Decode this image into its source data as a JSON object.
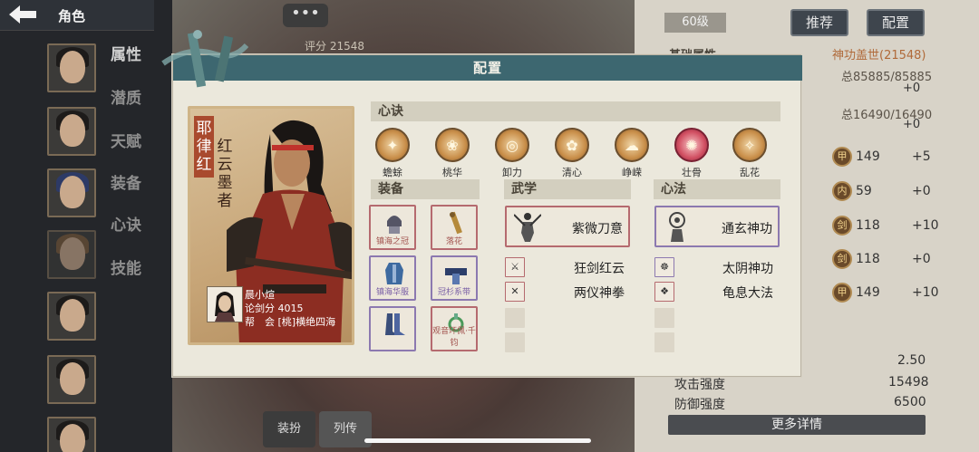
{
  "topbar": {
    "back_icon": "back-arrow-icon",
    "title": "角色"
  },
  "side_menu": [
    "属性",
    "潜质",
    "天赋",
    "装备",
    "心诀",
    "技能"
  ],
  "header": {
    "level": "60级",
    "recommend_label": "推荐",
    "config_label": "配置",
    "chat_label": "•••",
    "score": "评分 21548"
  },
  "stats_panel": {
    "base_label": "基础属性",
    "hero_title": "神功盖世(21548)",
    "hp": "总85885/85885",
    "hp_inc": "+0",
    "mp": "总16490/16490",
    "mp_inc": "+0",
    "rows": [
      {
        "icon": "甲",
        "value": "149",
        "inc": "+5"
      },
      {
        "icon": "内",
        "value": "59",
        "inc": "+0"
      },
      {
        "icon": "剑",
        "value": "118",
        "inc": "+10"
      },
      {
        "icon": "剑",
        "value": "118",
        "inc": "+0"
      },
      {
        "icon": "甲",
        "value": "149",
        "inc": "+10"
      }
    ],
    "extra_value": "2.50",
    "attack_label": "攻击强度",
    "attack_value": "15498",
    "defense_label": "防御强度",
    "defense_value": "6500",
    "more_label": "更多详情"
  },
  "bottom_tabs": [
    "装扮",
    "列传"
  ],
  "modal": {
    "title": "配置",
    "character": {
      "name": "耶律红",
      "title": "红云墨者",
      "player_name": "晨小煊",
      "sword_score": "论剑分 4015",
      "guild": "帮　会 [桃]横绝四海"
    },
    "heart_section": "心诀",
    "hearts": [
      {
        "label": "蟾蜍",
        "style": "gold"
      },
      {
        "label": "桃华",
        "style": "gold"
      },
      {
        "label": "卸力",
        "style": "gold"
      },
      {
        "label": "清心",
        "style": "gold"
      },
      {
        "label": "峥嵘",
        "style": "gold"
      },
      {
        "label": "壮骨",
        "style": "red"
      },
      {
        "label": "乱花",
        "style": "gold"
      }
    ],
    "equip_section": "装备",
    "equipment": [
      {
        "label": "镇海之冠",
        "rarity": "red"
      },
      {
        "label": "落花",
        "rarity": "red"
      },
      {
        "label": "镇海华服",
        "rarity": "purple"
      },
      {
        "label": "冠杉系带",
        "rarity": "purple"
      },
      {
        "label": "",
        "rarity": "purple"
      },
      {
        "label": "观音环佩·千钧",
        "rarity": "red"
      }
    ],
    "martial_section": "武学",
    "martial_main": "紫微刀意",
    "martial_skills": [
      "狂剑红云",
      "两仪神拳"
    ],
    "mind_section": "心法",
    "mind_main": "通玄神功",
    "mind_skills": [
      "太阴神功",
      "龟息大法"
    ],
    "colors": {
      "header": "#3d6770",
      "panel": "#ebe8dc",
      "red_border": "#b56a6f",
      "purple_border": "#8c79b0"
    }
  }
}
